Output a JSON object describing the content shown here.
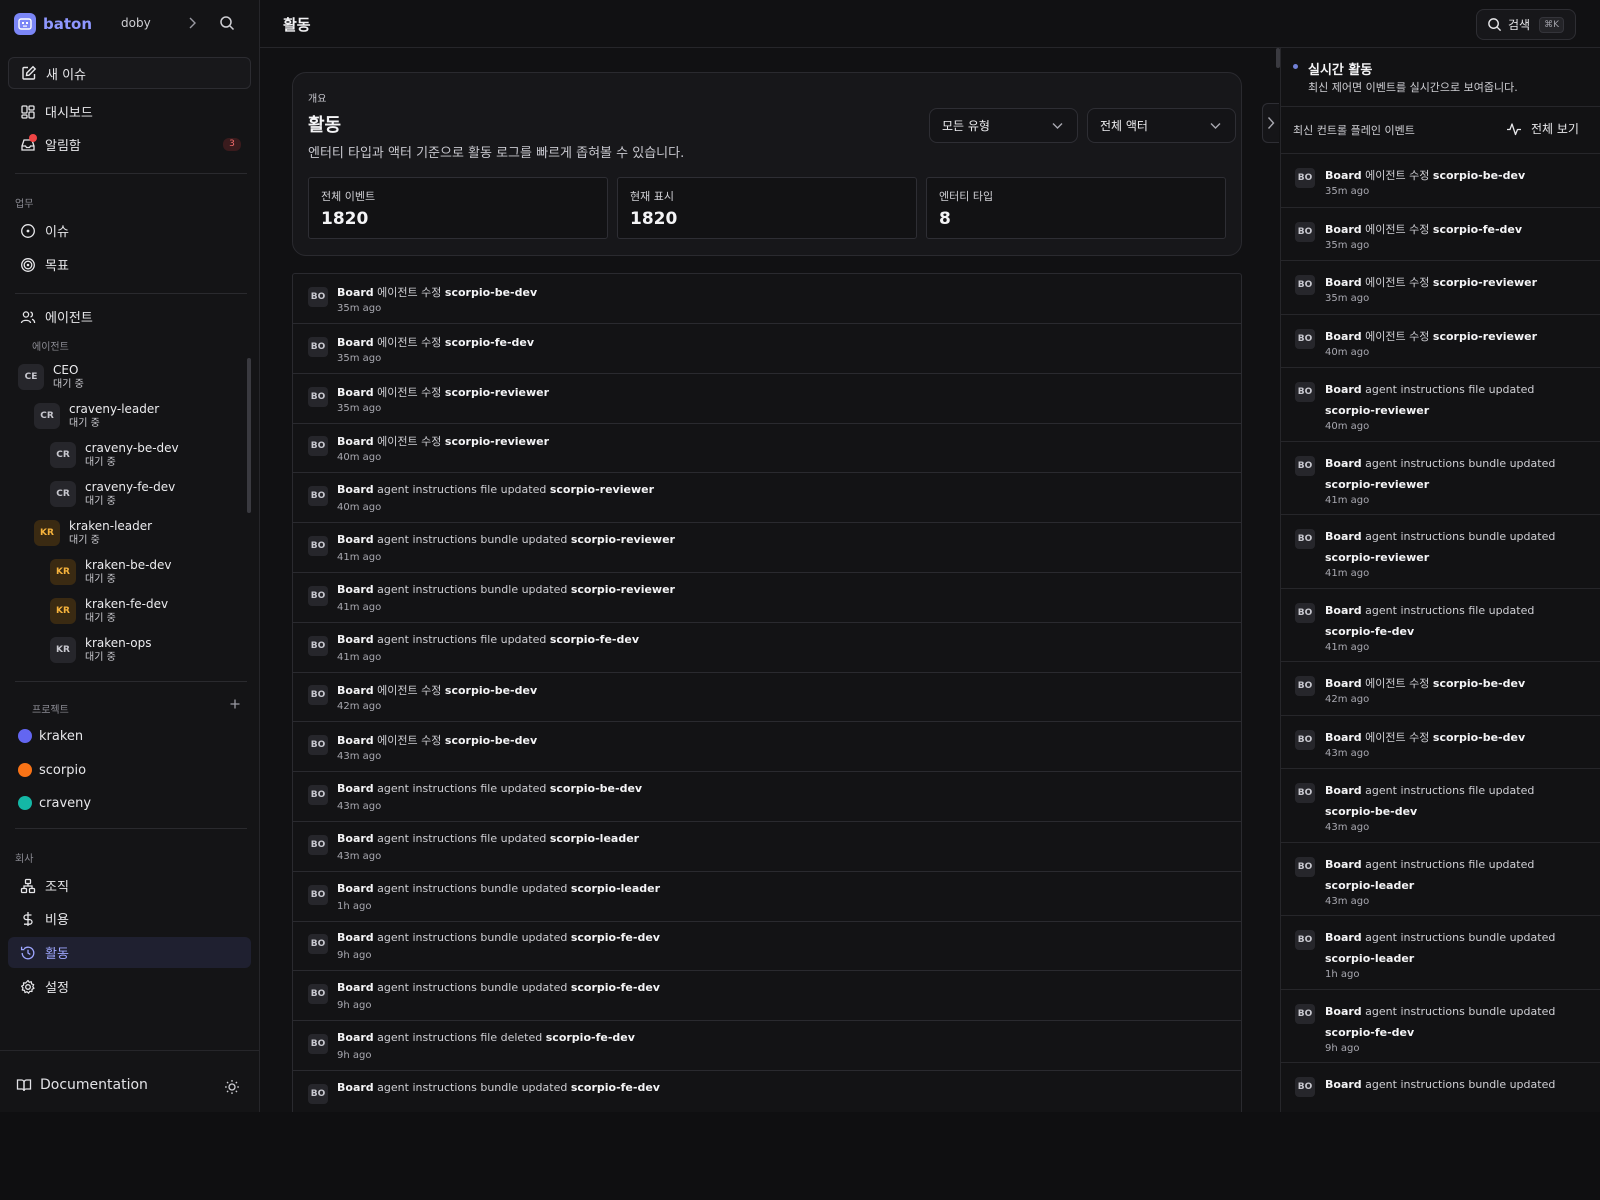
{
  "sidebar": {
    "brand": "baton",
    "company": "doby",
    "new_issue": "새 이슈",
    "dashboard": "대시보드",
    "inbox": "알림함",
    "inbox_count": "3",
    "work_section": "업무",
    "issues": "이슈",
    "goals": "목표",
    "agents": "에이전트",
    "agents_sub": "에이전트",
    "agent_tree": [
      {
        "initials": "CE",
        "name": "CEO",
        "status": "대기 중",
        "level": 0,
        "kraken": false
      },
      {
        "initials": "CR",
        "name": "craveny-leader",
        "status": "대기 중",
        "level": 1,
        "kraken": false
      },
      {
        "initials": "CR",
        "name": "craveny-be-dev",
        "status": "대기 중",
        "level": 2,
        "kraken": false
      },
      {
        "initials": "CR",
        "name": "craveny-fe-dev",
        "status": "대기 중",
        "level": 2,
        "kraken": false
      },
      {
        "initials": "KR",
        "name": "kraken-leader",
        "status": "대기 중",
        "level": 1,
        "kraken": true
      },
      {
        "initials": "KR",
        "name": "kraken-be-dev",
        "status": "대기 중",
        "level": 2,
        "kraken": true
      },
      {
        "initials": "KR",
        "name": "kraken-fe-dev",
        "status": "대기 중",
        "level": 2,
        "kraken": true
      },
      {
        "initials": "KR",
        "name": "kraken-ops",
        "status": "대기 중",
        "level": 2,
        "kraken": false
      }
    ],
    "projects_section": "프로젝트",
    "projects": [
      {
        "name": "kraken",
        "color": "#6366f1"
      },
      {
        "name": "scorpio",
        "color": "#f97316"
      },
      {
        "name": "craveny",
        "color": "#14b8a6"
      }
    ],
    "company_section": "회사",
    "org": "조직",
    "costs": "비용",
    "activity": "활동",
    "settings": "설정",
    "documentation": "Documentation"
  },
  "topbar": {
    "title": "활동",
    "search_label": "검색",
    "search_shortcut": "⌘K"
  },
  "overview": {
    "eyebrow": "개요",
    "title": "활동",
    "description": "엔터티 타입과 액터 기준으로 활동 로그를 빠르게 좁혀볼 수 있습니다.",
    "filter_type": "모든 유형",
    "filter_actor": "전체 액터",
    "stats": [
      {
        "label": "전체 이벤트",
        "value": "1820"
      },
      {
        "label": "현재 표시",
        "value": "1820"
      },
      {
        "label": "엔터티 타입",
        "value": "8"
      }
    ]
  },
  "activity_rows": [
    {
      "avatar": "BO",
      "actor": "Board",
      "action": "에이전트 수정",
      "target": "scorpio-be-dev",
      "time": "35m ago"
    },
    {
      "avatar": "BO",
      "actor": "Board",
      "action": "에이전트 수정",
      "target": "scorpio-fe-dev",
      "time": "35m ago"
    },
    {
      "avatar": "BO",
      "actor": "Board",
      "action": "에이전트 수정",
      "target": "scorpio-reviewer",
      "time": "35m ago"
    },
    {
      "avatar": "BO",
      "actor": "Board",
      "action": "에이전트 수정",
      "target": "scorpio-reviewer",
      "time": "40m ago"
    },
    {
      "avatar": "BO",
      "actor": "Board",
      "action": "agent instructions file updated",
      "target": "scorpio-reviewer",
      "time": "40m ago"
    },
    {
      "avatar": "BO",
      "actor": "Board",
      "action": "agent instructions bundle updated",
      "target": "scorpio-reviewer",
      "time": "41m ago"
    },
    {
      "avatar": "BO",
      "actor": "Board",
      "action": "agent instructions bundle updated",
      "target": "scorpio-reviewer",
      "time": "41m ago"
    },
    {
      "avatar": "BO",
      "actor": "Board",
      "action": "agent instructions file updated",
      "target": "scorpio-fe-dev",
      "time": "41m ago"
    },
    {
      "avatar": "BO",
      "actor": "Board",
      "action": "에이전트 수정",
      "target": "scorpio-be-dev",
      "time": "42m ago"
    },
    {
      "avatar": "BO",
      "actor": "Board",
      "action": "에이전트 수정",
      "target": "scorpio-be-dev",
      "time": "43m ago"
    },
    {
      "avatar": "BO",
      "actor": "Board",
      "action": "agent instructions file updated",
      "target": "scorpio-be-dev",
      "time": "43m ago"
    },
    {
      "avatar": "BO",
      "actor": "Board",
      "action": "agent instructions file updated",
      "target": "scorpio-leader",
      "time": "43m ago"
    },
    {
      "avatar": "BO",
      "actor": "Board",
      "action": "agent instructions bundle updated",
      "target": "scorpio-leader",
      "time": "1h ago"
    },
    {
      "avatar": "BO",
      "actor": "Board",
      "action": "agent instructions bundle updated",
      "target": "scorpio-fe-dev",
      "time": "9h ago"
    },
    {
      "avatar": "BO",
      "actor": "Board",
      "action": "agent instructions bundle updated",
      "target": "scorpio-fe-dev",
      "time": "9h ago"
    },
    {
      "avatar": "BO",
      "actor": "Board",
      "action": "agent instructions file deleted",
      "target": "scorpio-fe-dev",
      "time": "9h ago"
    },
    {
      "avatar": "BO",
      "actor": "Board",
      "action": "agent instructions bundle updated",
      "target": "scorpio-fe-dev",
      "time": ""
    }
  ],
  "live": {
    "title": "실시간 활동",
    "subtitle": "최신 제어면 이벤트를 실시간으로 보여줍니다.",
    "list_label": "최신 컨트롤 플레인 이벤트",
    "view_all": "전체 보기",
    "events": [
      {
        "avatar": "BO",
        "actor": "Board",
        "action": "에이전트 수정",
        "target": "scorpio-be-dev",
        "time": "35m ago",
        "wrap": false
      },
      {
        "avatar": "BO",
        "actor": "Board",
        "action": "에이전트 수정",
        "target": "scorpio-fe-dev",
        "time": "35m ago",
        "wrap": false
      },
      {
        "avatar": "BO",
        "actor": "Board",
        "action": "에이전트 수정",
        "target": "scorpio-reviewer",
        "time": "35m ago",
        "wrap": false
      },
      {
        "avatar": "BO",
        "actor": "Board",
        "action": "에이전트 수정",
        "target": "scorpio-reviewer",
        "time": "40m ago",
        "wrap": false
      },
      {
        "avatar": "BO",
        "actor": "Board",
        "action": "agent instructions file updated",
        "target": "scorpio-reviewer",
        "time": "40m ago",
        "wrap": true
      },
      {
        "avatar": "BO",
        "actor": "Board",
        "action": "agent instructions bundle updated",
        "target": "scorpio-reviewer",
        "time": "41m ago",
        "wrap": true
      },
      {
        "avatar": "BO",
        "actor": "Board",
        "action": "agent instructions bundle updated",
        "target": "scorpio-reviewer",
        "time": "41m ago",
        "wrap": true
      },
      {
        "avatar": "BO",
        "actor": "Board",
        "action": "agent instructions file updated",
        "target": "scorpio-fe-dev",
        "time": "41m ago",
        "wrap": true
      },
      {
        "avatar": "BO",
        "actor": "Board",
        "action": "에이전트 수정",
        "target": "scorpio-be-dev",
        "time": "42m ago",
        "wrap": false
      },
      {
        "avatar": "BO",
        "actor": "Board",
        "action": "에이전트 수정",
        "target": "scorpio-be-dev",
        "time": "43m ago",
        "wrap": false
      },
      {
        "avatar": "BO",
        "actor": "Board",
        "action": "agent instructions file updated",
        "target": "scorpio-be-dev",
        "time": "43m ago",
        "wrap": true
      },
      {
        "avatar": "BO",
        "actor": "Board",
        "action": "agent instructions file updated",
        "target": "scorpio-leader",
        "time": "43m ago",
        "wrap": true
      },
      {
        "avatar": "BO",
        "actor": "Board",
        "action": "agent instructions bundle updated",
        "target": "scorpio-leader",
        "time": "1h ago",
        "wrap": true
      },
      {
        "avatar": "BO",
        "actor": "Board",
        "action": "agent instructions bundle updated",
        "target": "scorpio-fe-dev",
        "time": "9h ago",
        "wrap": true
      },
      {
        "avatar": "BO",
        "actor": "Board",
        "action": "agent instructions bundle updated",
        "target": "",
        "time": "",
        "wrap": true
      }
    ]
  }
}
